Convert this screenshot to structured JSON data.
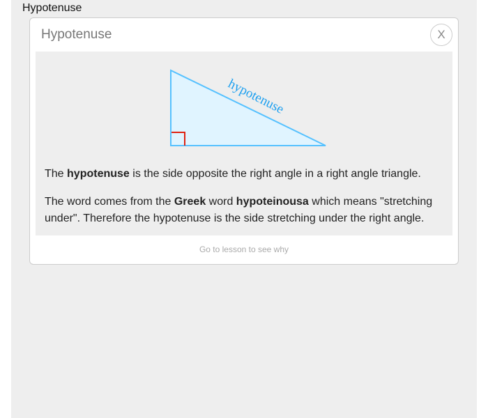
{
  "page_title": "Hypotenuse",
  "card": {
    "title": "Hypotenuse",
    "close_label": "X",
    "diagram_label": "hypotenuse",
    "colors": {
      "triangle_stroke": "#55c1ff",
      "triangle_fill": "#e0f4ff",
      "right_angle": "#e02010"
    },
    "para1": {
      "t1": "The ",
      "b1": "hypotenuse",
      "t2": " is the side opposite the right angle in a right angle triangle."
    },
    "para2": {
      "t1": "The word comes from the ",
      "b1": "Greek",
      "t2": " word ",
      "b2": "hypoteinousa",
      "t3": " which means \"stretching under\". Therefore the hypotenuse is the side stretching under the right angle."
    },
    "lesson_link": "Go to lesson to see why"
  }
}
